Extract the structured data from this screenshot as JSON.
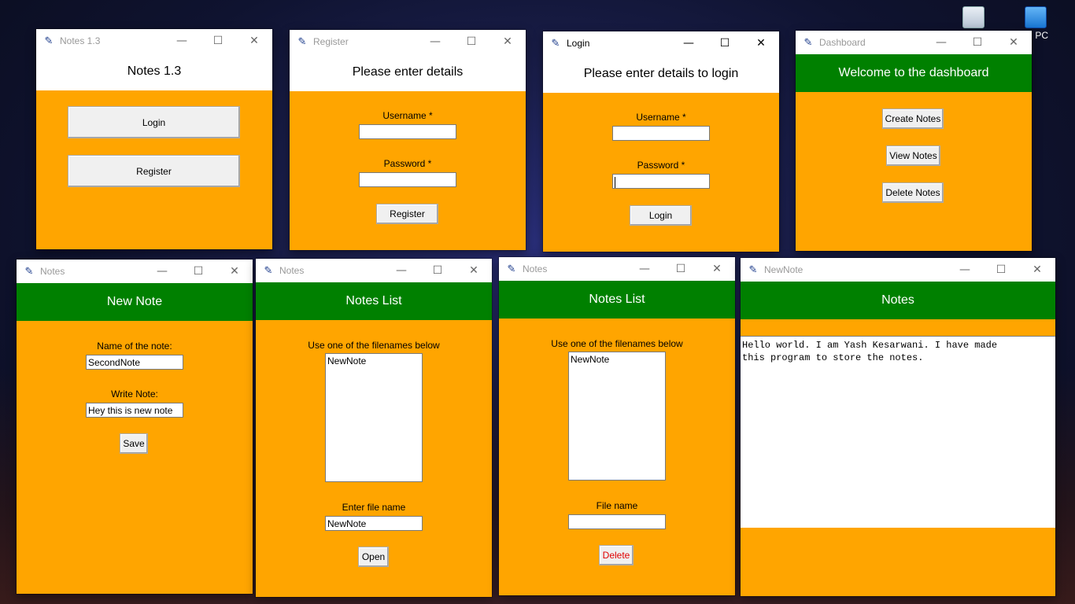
{
  "desktop": {
    "icons": [
      {
        "name": "recycle-bin-icon",
        "label": ""
      },
      {
        "name": "this-pc-icon",
        "label": "PC"
      }
    ]
  },
  "windows": {
    "main": {
      "title": "Notes 1.3",
      "heading": "Notes 1.3",
      "login_label": "Login",
      "register_label": "Register"
    },
    "register": {
      "title": "Register",
      "heading": "Please enter details",
      "username_label": "Username *",
      "password_label": "Password *",
      "username_value": "",
      "password_value": "",
      "register_label": "Register"
    },
    "login": {
      "title": "Login",
      "heading": "Please enter details to login",
      "username_label": "Username *",
      "password_label": "Password *",
      "username_value": "",
      "password_value": "",
      "login_label": "Login"
    },
    "dashboard": {
      "title": "Dashboard",
      "heading": "Welcome to the dashboard",
      "create_label": "Create Notes",
      "view_label": "View Notes",
      "delete_label": "Delete Notes"
    },
    "new_note": {
      "title": "Notes",
      "heading": "New Note",
      "name_label": "Name of the note:",
      "name_value": "SecondNote",
      "write_label": "Write Note:",
      "write_value": "Hey this is new note",
      "save_label": "Save"
    },
    "notes_list_open": {
      "title": "Notes",
      "heading": "Notes List",
      "instruction": "Use one of the filenames below",
      "files": [
        "NewNote"
      ],
      "filename_label": "Enter file name",
      "filename_value": "NewNote",
      "open_label": "Open"
    },
    "notes_list_delete": {
      "title": "Notes",
      "heading": "Notes List",
      "instruction": "Use one of the filenames below",
      "files": [
        "NewNote"
      ],
      "filename_label": "File name",
      "filename_value": "",
      "delete_label": "Delete"
    },
    "note_view": {
      "title": "NewNote",
      "heading": "Notes",
      "content": "Hello world. I am Yash Kesarwani. I have made\nthis program to store the notes."
    }
  },
  "window_controls": {
    "minimize": "—",
    "maximize": "☐",
    "close": "✕"
  },
  "colors": {
    "body": "#ffa500",
    "header_green": "#008000",
    "delete_text": "#e00000"
  }
}
